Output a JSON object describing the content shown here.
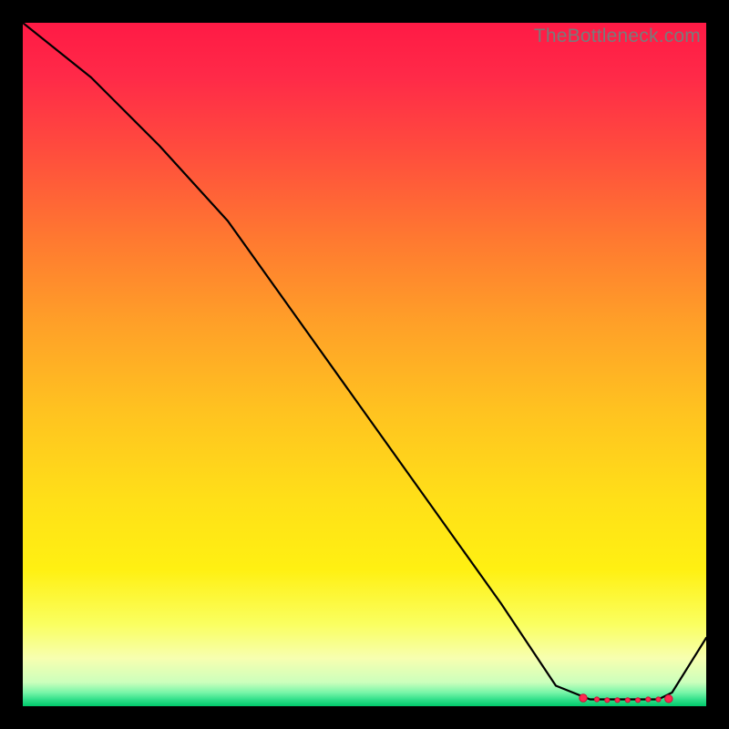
{
  "watermark": "TheBottleneck.com",
  "chart_data": {
    "type": "line",
    "title": "",
    "xlabel": "",
    "ylabel": "",
    "xlim": [
      0,
      100
    ],
    "ylim": [
      0,
      100
    ],
    "grid": false,
    "series": [
      {
        "name": "bottleneck-curve",
        "x": [
          0,
          10,
          20,
          30,
          40,
          50,
          60,
          70,
          78,
          83,
          87,
          90,
          93,
          95,
          100
        ],
        "values": [
          100,
          92,
          82,
          71,
          57,
          43,
          29,
          15,
          3,
          1,
          1,
          1,
          1,
          2,
          10
        ]
      }
    ],
    "markers": {
      "name": "optimal-range",
      "x": [
        82,
        84,
        85.5,
        87,
        88.5,
        90,
        91.5,
        93,
        94.5
      ],
      "values": [
        1.2,
        1.0,
        0.9,
        0.9,
        0.9,
        0.9,
        1.0,
        1.0,
        1.1
      ]
    },
    "gradient_meaning": "top_red_bad_bottom_green_good"
  }
}
